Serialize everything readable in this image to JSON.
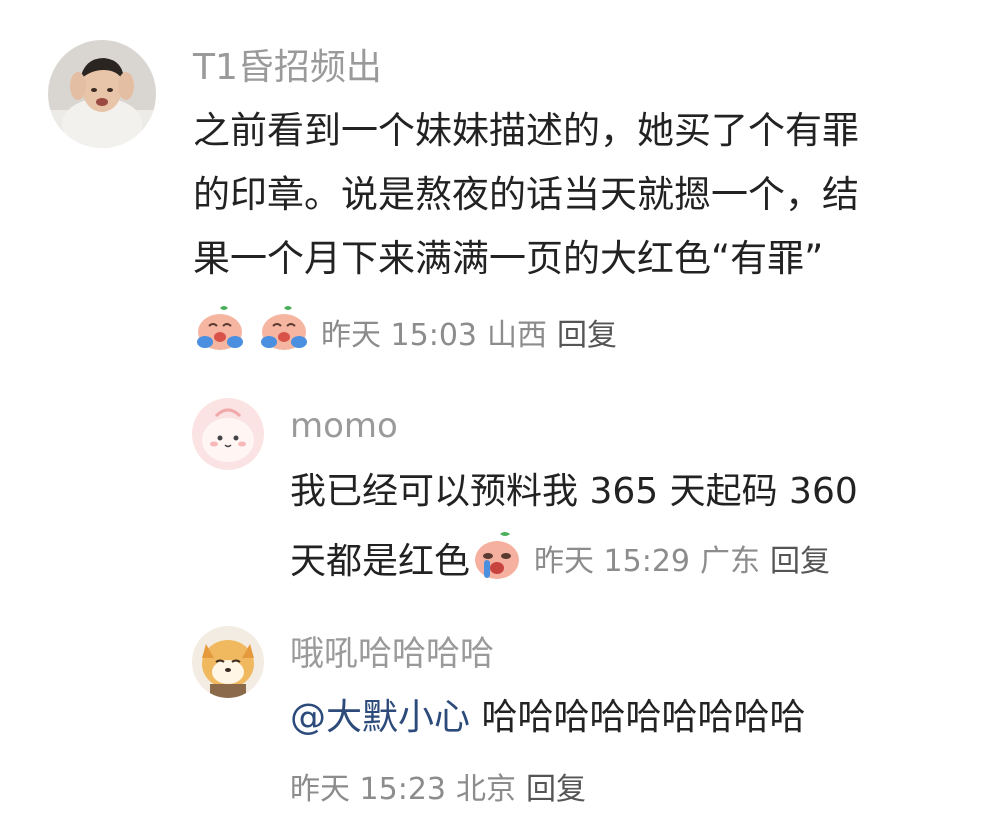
{
  "comments": [
    {
      "username": "T1昏招频出",
      "lines": [
        "之前看到一个妹妹描述的，她买了个有罪",
        "的印章。说是熬夜的话当天就摁一个，结",
        "果一个月下来满满一页的大红色“有罪”"
      ],
      "emojis": [
        "crying-laughing-peach-emoji",
        "crying-laughing-peach-emoji"
      ],
      "time": "昨天 15:03",
      "location": "山西",
      "reply_label": "回复"
    },
    {
      "username": "momo",
      "line1": "我已经可以预料我 365 天起码 360",
      "line2": "天都是红色",
      "emoji": "crying-peach-emoji",
      "time": "昨天 15:29",
      "location": "广东",
      "reply_label": "回复"
    },
    {
      "username": "哦吼哈哈哈哈",
      "mention": "@大默小心",
      "text": " 哈哈哈哈哈哈哈哈哈",
      "time": "昨天 15:23",
      "location": "北京",
      "reply_label": "回复"
    }
  ],
  "colors": {
    "username": "#9a9a9a",
    "text": "#222222",
    "meta": "#8c8c8c",
    "mention": "#2c4a7a"
  }
}
